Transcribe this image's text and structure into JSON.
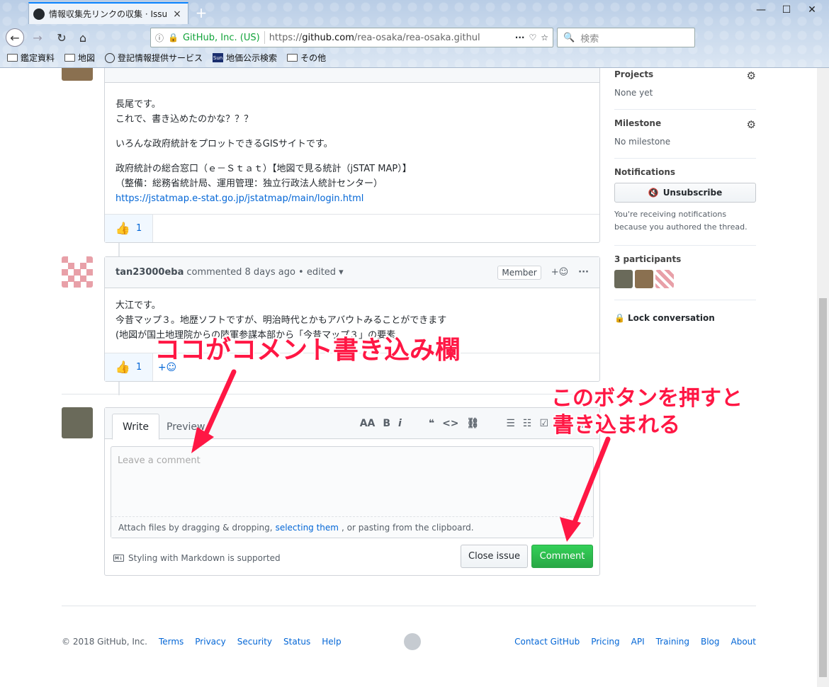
{
  "browser": {
    "tab_title": "情報収集先リンクの収集 · Issue",
    "tab_close": "×",
    "new_tab": "+",
    "url_identity": "GitHub, Inc. (US)",
    "url_prefix": "https://",
    "url_domain": "github.com",
    "url_path": "/rea-osaka/rea-osaka.githul",
    "search_placeholder": "検索",
    "bookmarks": [
      {
        "label": "鑑定資料",
        "icon": "folder-icon"
      },
      {
        "label": "地図",
        "icon": "folder-icon"
      },
      {
        "label": "登記情報提供サービス",
        "icon": "globe-icon"
      },
      {
        "label": "地価公示検索",
        "icon": "sun-icon"
      },
      {
        "label": "その他",
        "icon": "folder-icon"
      }
    ]
  },
  "comment1": {
    "body_lines": [
      "長尾です。",
      "これで、書き込めたのかな？？？"
    ],
    "para2": "いろんな政府統計をプロットできるGISサイトです。",
    "para3_line1": "政府統計の総合窓口（ｅ－Ｓｔａｔ）【地図で見る統計（jSTAT MAP）】",
    "para3_line2": "（整備：総務省統計局、運用管理：独立行政法人統計センター）",
    "link": "https://jstatmap.e-stat.go.jp/jstatmap/main/login.html",
    "reaction_count": "1"
  },
  "comment2": {
    "author": "tan23000eba",
    "meta": "commented 8 days ago • edited ▾",
    "badge": "Member",
    "body_line1": "大江です。",
    "body_line2": "今昔マップ３。地歴ソフトですが、明治時代とかもアバウトみることができます",
    "body_line3": "(地図が国土地理院からの陸軍参謀本部から「今昔マップ３」の要素",
    "reaction_count": "1",
    "add_reaction": "+☺"
  },
  "sidebar": {
    "projects_label": "Projects",
    "projects_value": "None yet",
    "milestone_label": "Milestone",
    "milestone_value": "No milestone",
    "notifications_label": "Notifications",
    "unsubscribe_label": "Unsubscribe",
    "notification_note": "You're receiving notifications because you authored the thread.",
    "participants_label": "3 participants",
    "lock_label": "Lock conversation"
  },
  "new_comment": {
    "tab_write": "Write",
    "tab_preview": "Preview",
    "placeholder": "Leave a comment",
    "drop_prefix": "Attach files by dragging & dropping,",
    "drop_link": "selecting them",
    "drop_suffix": ", or pasting from the clipboard.",
    "markdown_note": "Styling with Markdown is supported",
    "close_button": "Close issue",
    "comment_button": "Comment"
  },
  "footer": {
    "copyright": "© 2018 GitHub, Inc.",
    "left_links": [
      "Terms",
      "Privacy",
      "Security",
      "Status",
      "Help"
    ],
    "right_links": [
      "Contact GitHub",
      "Pricing",
      "API",
      "Training",
      "Blog",
      "About"
    ]
  },
  "annotations": {
    "comment_field": "ココがコメント書き込み欄",
    "button_line1": "このボタンを押すと",
    "button_line2": "書き込まれる",
    "color": "#ff1744"
  }
}
